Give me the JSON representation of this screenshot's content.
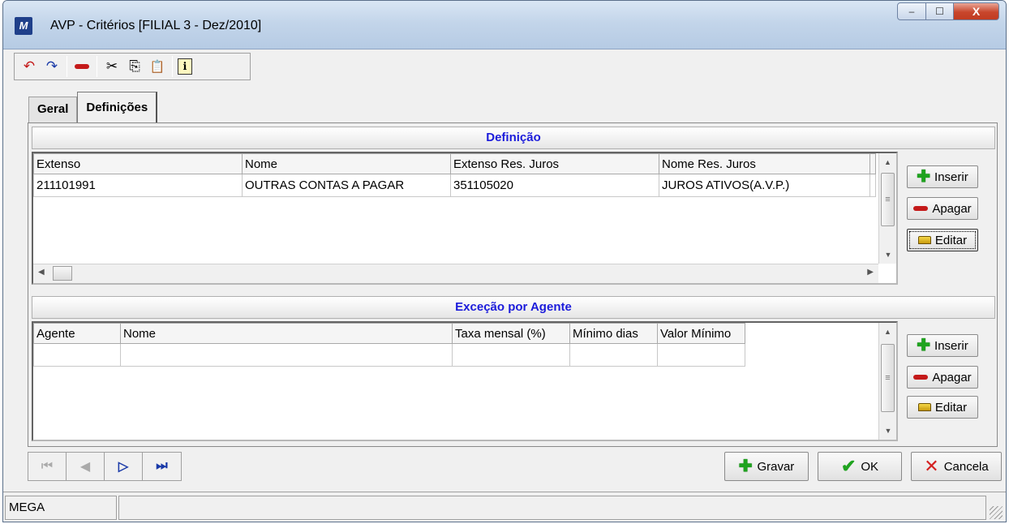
{
  "window": {
    "title": "AVP - Critérios [FILIAL 3 - Dez/2010]",
    "logo": "M"
  },
  "titlebar_buttons": {
    "minimize": "‒",
    "maximize": "☐",
    "close": "X"
  },
  "toolbar": {
    "undo_icon": "↶",
    "redo_icon": "↷",
    "delete_icon": "—",
    "cut_icon": "✂",
    "copy_icon": "⎘",
    "paste_icon": "📋",
    "info_icon": "ℹ"
  },
  "tabs": [
    {
      "label": "Geral"
    },
    {
      "label": "Definições"
    }
  ],
  "definicao": {
    "title": "Definição",
    "columns": [
      "Extenso",
      "Nome",
      "Extenso Res. Juros",
      "Nome Res. Juros"
    ],
    "rows": [
      [
        "211101991",
        "OUTRAS CONTAS A PAGAR",
        "351105020",
        "JUROS ATIVOS(A.V.P.)"
      ]
    ],
    "buttons": {
      "insert": "Inserir",
      "delete": "Apagar",
      "edit": "Editar"
    }
  },
  "excecao": {
    "title": "Exceção por Agente",
    "columns": [
      "Agente",
      "Nome",
      "Taxa mensal (%)",
      "Mínimo dias",
      "Valor Mínimo"
    ],
    "buttons": {
      "insert": "Inserir",
      "delete": "Apagar",
      "edit": "Editar"
    }
  },
  "navigation": {
    "first": "⏮",
    "prev": "◀",
    "next": "▷",
    "last": "⏭"
  },
  "actions": {
    "save": "Gravar",
    "ok": "OK",
    "cancel": "Cancela"
  },
  "status": {
    "company": "MEGA",
    "message": ""
  }
}
